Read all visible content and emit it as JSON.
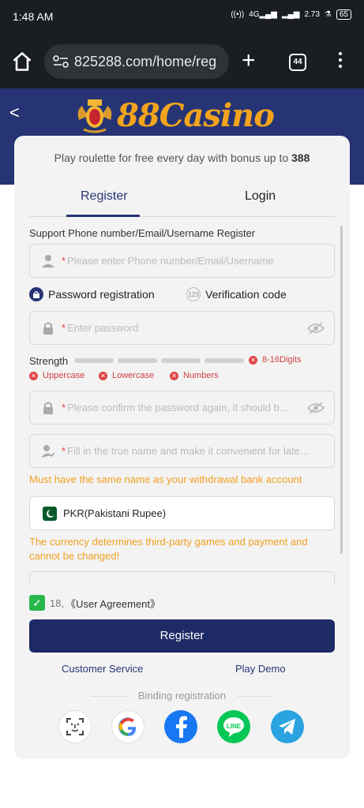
{
  "status": {
    "time": "1:48 AM",
    "net_speed": "2.73",
    "battery": "65"
  },
  "browser": {
    "url": "825288.com/home/reg",
    "tab_count": "44"
  },
  "brand": {
    "logo_text": "88Casino",
    "accent": "#f2a41c",
    "header_bg": "#263475"
  },
  "card": {
    "promo_text": "Play roulette for free every day with bonus up to",
    "promo_amount": "388",
    "tabs": [
      {
        "label": "Register",
        "active": true
      },
      {
        "label": "Login",
        "active": false
      }
    ],
    "support_label": "Support Phone number/Email/Username Register",
    "account_field": {
      "placeholder": "Please enter Phone number/Email/Username",
      "required": "*"
    },
    "modes": [
      {
        "label": "Password registration",
        "selected": true,
        "icon": "lock-icon"
      },
      {
        "label": "Verification code",
        "selected": false,
        "icon_text": "123"
      }
    ],
    "password_field": {
      "placeholder": "Enter password",
      "required": "*"
    },
    "strength": {
      "label": "Strength",
      "level": 0,
      "rules": [
        "8-16Digits",
        "Uppercase",
        "Lowercase",
        "Numbers"
      ]
    },
    "confirm_field": {
      "placeholder": "Please confirm the password again, it should b...",
      "required": "*"
    },
    "name_field": {
      "placeholder": "Fill in the true name and make it convenient for later ...",
      "required": "*"
    },
    "name_warning": "Must have the same name as your withdrawal bank account",
    "currency": {
      "value": "PKR(Pakistani Rupee)"
    },
    "currency_warning": "The currency determines third-party games and payment and cannot be changed!",
    "agreement": {
      "checked": true,
      "age": "18,",
      "label": "《User Agreement》"
    },
    "register_button": "Register",
    "customer_service": "Customer Service",
    "play_demo": "Play Demo",
    "binding_label": "Binding registration",
    "socials": [
      "face-id-icon",
      "google-icon",
      "facebook-icon",
      "line-icon",
      "telegram-icon"
    ],
    "social_line_text": "LINE"
  }
}
